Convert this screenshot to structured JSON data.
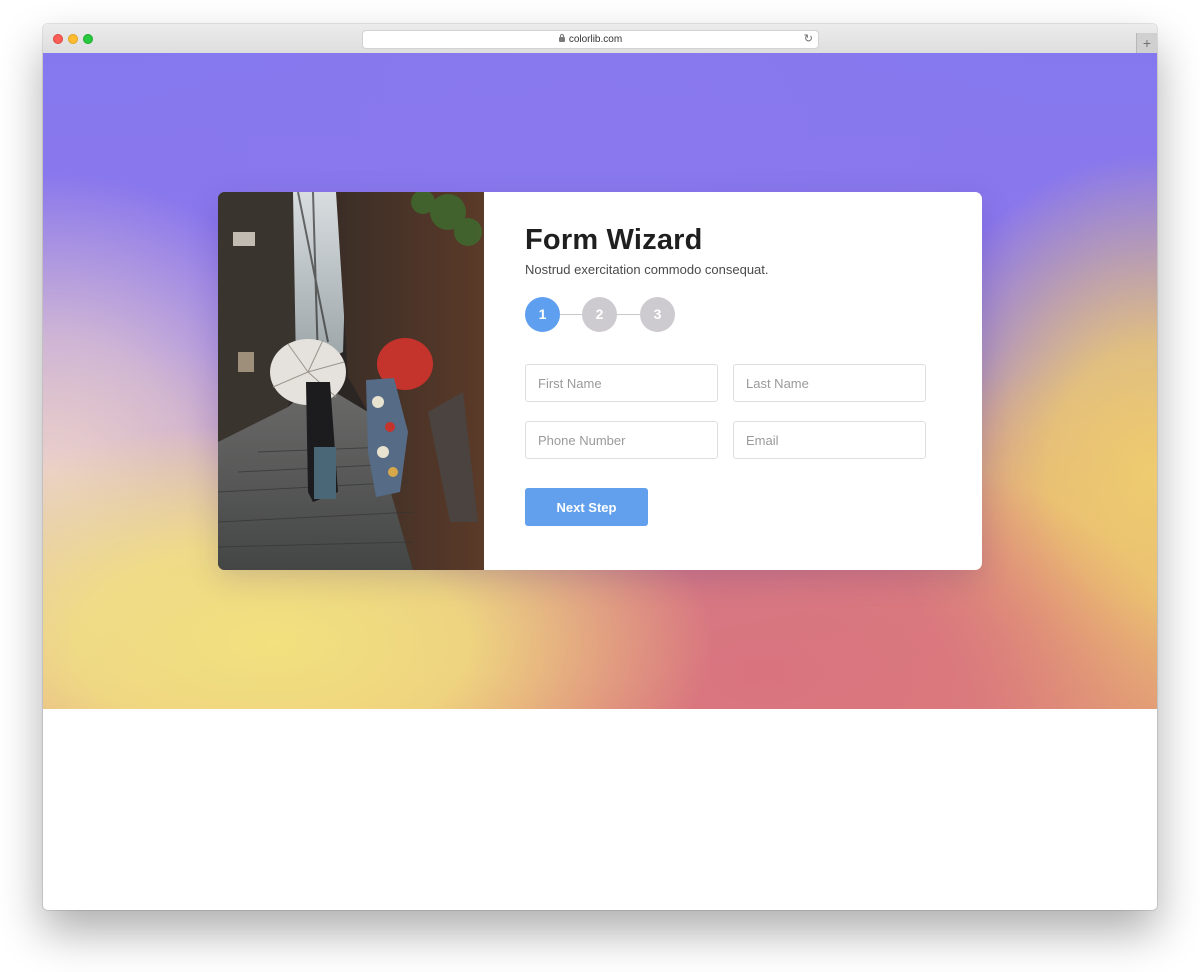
{
  "browser": {
    "url": "colorlib.com",
    "new_tab_icon": "plus-icon",
    "reload_icon": "reload-icon",
    "lock_icon": "lock-icon"
  },
  "form": {
    "title": "Form Wizard",
    "subtitle": "Nostrud exercitation commodo consequat.",
    "steps": [
      {
        "label": "1",
        "state": "active"
      },
      {
        "label": "2",
        "state": "inactive"
      },
      {
        "label": "3",
        "state": "inactive"
      }
    ],
    "fields": {
      "first_name": {
        "placeholder": "First Name",
        "value": ""
      },
      "last_name": {
        "placeholder": "Last Name",
        "value": ""
      },
      "phone": {
        "placeholder": "Phone Number",
        "value": ""
      },
      "email": {
        "placeholder": "Email",
        "value": ""
      }
    },
    "next_button": "Next Step"
  },
  "colors": {
    "accent": "#5ea0ef",
    "button": "#62a0ee",
    "step_inactive": "#cdcbcf",
    "title_text": "#1f1f1f"
  }
}
